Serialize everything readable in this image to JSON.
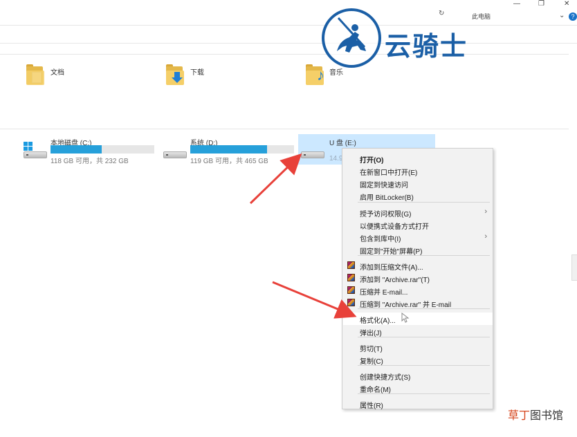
{
  "window": {
    "title": "此电脑",
    "minimize": "—",
    "restore": "❐",
    "close": "✕",
    "expand": "⌄",
    "help": "?"
  },
  "folders": [
    {
      "label": "文档",
      "icon": "document-folder-icon"
    },
    {
      "label": "下载",
      "icon": "download-folder-icon"
    },
    {
      "label": "音乐",
      "icon": "music-folder-icon"
    }
  ],
  "drives": [
    {
      "name": "本地磁盘 (C:)",
      "info": "118 GB 可用，共 232 GB",
      "used_fraction": 0.49,
      "icon": "windows-drive-icon"
    },
    {
      "name": "系统 (D:)",
      "info": "119 GB 可用，共 465 GB",
      "used_fraction": 0.74,
      "icon": "drive-icon"
    },
    {
      "name": "U 盘 (E:)",
      "info": "14.9",
      "icon": "usb-drive-icon",
      "selected": true
    }
  ],
  "context_menu": {
    "items": [
      {
        "label": "打开(O)",
        "bold": true
      },
      {
        "label": "在新窗口中打开(E)"
      },
      {
        "label": "固定到快速访问"
      },
      {
        "label": "启用 BitLocker(B)"
      },
      {
        "label": "授予访问权限(G)",
        "submenu": true
      },
      {
        "label": "以便携式设备方式打开"
      },
      {
        "label": "包含到库中(I)",
        "submenu": true
      },
      {
        "label": "固定到\"开始\"屏幕(P)"
      },
      {
        "label": "添加到压缩文件(A)...",
        "icon": "winrar-icon"
      },
      {
        "label": "添加到 \"Archive.rar\"(T)",
        "icon": "winrar-icon"
      },
      {
        "label": "压缩并 E-mail...",
        "icon": "winrar-icon"
      },
      {
        "label": "压缩到 \"Archive.rar\" 并 E-mail",
        "icon": "winrar-icon"
      },
      {
        "label": "格式化(A)...",
        "highlighted": true
      },
      {
        "label": "弹出(J)"
      },
      {
        "label": "剪切(T)"
      },
      {
        "label": "复制(C)"
      },
      {
        "label": "创建快捷方式(S)"
      },
      {
        "label": "重命名(M)"
      },
      {
        "label": "属性(R)"
      }
    ],
    "submenu_glyph": "›"
  },
  "watermark": {
    "brand": "云骑士",
    "corner_a": "草丁",
    "corner_b": "图书馆"
  },
  "colors": {
    "accent": "#26a0da",
    "selection": "#cce8ff",
    "arrow": "#e8413a",
    "brand": "#1b5fa6"
  }
}
